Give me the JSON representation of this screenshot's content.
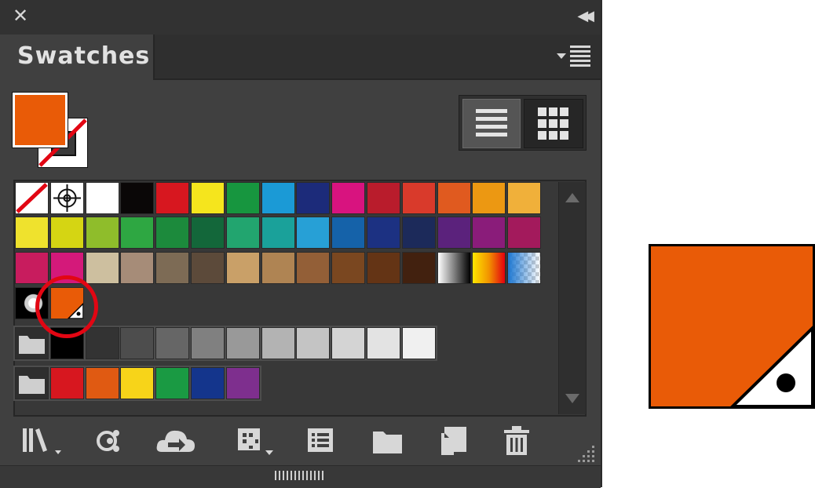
{
  "panel": {
    "title": "Swatches",
    "accent_color": "#e95b07"
  },
  "icons": {
    "close": "close-icon",
    "collapse": "collapse-panel-icon",
    "menu": "panel-menu-icon",
    "list_view": "list-view-icon",
    "grid_view": "grid-view-icon",
    "library": "swatch-libraries-icon",
    "show_kinds": "show-swatch-kinds-icon",
    "cloud": "creative-cloud-sync-icon",
    "swatch_options_grid": "swatch-options-icon",
    "color_group": "color-group-icon",
    "new_group": "new-color-group-icon",
    "new_swatch": "new-swatch-icon",
    "delete": "delete-swatch-icon"
  },
  "swatches": {
    "row1": [
      "none",
      "registration",
      "#ffffff",
      "#0a0707",
      "#d7171f",
      "#f5e51d",
      "#17963f",
      "#1b9ad6",
      "#1c2b7a",
      "#d8137f",
      "#b91c2c",
      "#d93a2b",
      "#e05a1f",
      "#ec9812",
      "#f0b03a"
    ],
    "row2": [
      "#efe22d",
      "#d5d513",
      "#8fbd2b",
      "#2ea742",
      "#1c8a3c",
      "#13673a",
      "#22a56f",
      "#1aa19a",
      "#27a0d6",
      "#1562a9",
      "#1c3182",
      "#1c2a5a",
      "#5b227c",
      "#8a1c7a",
      "#a31a5c"
    ],
    "row3": [
      "#c81c5e",
      "#d4197a",
      "#cdbf9f",
      "#a68c78",
      "#7d6b55",
      "#5c4a3a",
      "#c9a068",
      "#af8453",
      "#935f37",
      "#7a4720",
      "#643415",
      "#42210f",
      "gradient-bw",
      "gradient-yellow",
      "gradient-blue"
    ],
    "row4": [
      "pattern-black",
      "#e95b07"
    ],
    "gray_group": [
      "#000000",
      "#333333",
      "#4d4d4d",
      "#666666",
      "#808080",
      "#999999",
      "#b3b3b3",
      "#c4c4c4",
      "#d4d4d4",
      "#e3e3e3",
      "#f0f0f0"
    ],
    "color_group": [
      "#d7171f",
      "#e05a12",
      "#f7d419",
      "#1a9a43",
      "#14358c",
      "#7e2f8e"
    ]
  },
  "highlight_color": "#e20613"
}
